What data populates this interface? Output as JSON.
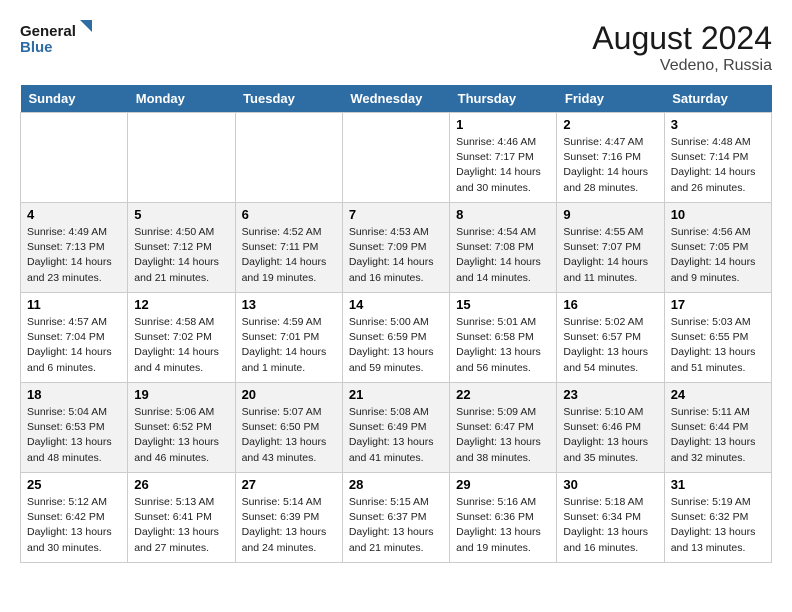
{
  "header": {
    "logo_line1": "General",
    "logo_line2": "Blue",
    "month_year": "August 2024",
    "location": "Vedeno, Russia"
  },
  "days_of_week": [
    "Sunday",
    "Monday",
    "Tuesday",
    "Wednesday",
    "Thursday",
    "Friday",
    "Saturday"
  ],
  "weeks": [
    [
      {
        "day": "",
        "info": ""
      },
      {
        "day": "",
        "info": ""
      },
      {
        "day": "",
        "info": ""
      },
      {
        "day": "",
        "info": ""
      },
      {
        "day": "1",
        "info": "Sunrise: 4:46 AM\nSunset: 7:17 PM\nDaylight: 14 hours\nand 30 minutes."
      },
      {
        "day": "2",
        "info": "Sunrise: 4:47 AM\nSunset: 7:16 PM\nDaylight: 14 hours\nand 28 minutes."
      },
      {
        "day": "3",
        "info": "Sunrise: 4:48 AM\nSunset: 7:14 PM\nDaylight: 14 hours\nand 26 minutes."
      }
    ],
    [
      {
        "day": "4",
        "info": "Sunrise: 4:49 AM\nSunset: 7:13 PM\nDaylight: 14 hours\nand 23 minutes."
      },
      {
        "day": "5",
        "info": "Sunrise: 4:50 AM\nSunset: 7:12 PM\nDaylight: 14 hours\nand 21 minutes."
      },
      {
        "day": "6",
        "info": "Sunrise: 4:52 AM\nSunset: 7:11 PM\nDaylight: 14 hours\nand 19 minutes."
      },
      {
        "day": "7",
        "info": "Sunrise: 4:53 AM\nSunset: 7:09 PM\nDaylight: 14 hours\nand 16 minutes."
      },
      {
        "day": "8",
        "info": "Sunrise: 4:54 AM\nSunset: 7:08 PM\nDaylight: 14 hours\nand 14 minutes."
      },
      {
        "day": "9",
        "info": "Sunrise: 4:55 AM\nSunset: 7:07 PM\nDaylight: 14 hours\nand 11 minutes."
      },
      {
        "day": "10",
        "info": "Sunrise: 4:56 AM\nSunset: 7:05 PM\nDaylight: 14 hours\nand 9 minutes."
      }
    ],
    [
      {
        "day": "11",
        "info": "Sunrise: 4:57 AM\nSunset: 7:04 PM\nDaylight: 14 hours\nand 6 minutes."
      },
      {
        "day": "12",
        "info": "Sunrise: 4:58 AM\nSunset: 7:02 PM\nDaylight: 14 hours\nand 4 minutes."
      },
      {
        "day": "13",
        "info": "Sunrise: 4:59 AM\nSunset: 7:01 PM\nDaylight: 14 hours\nand 1 minute."
      },
      {
        "day": "14",
        "info": "Sunrise: 5:00 AM\nSunset: 6:59 PM\nDaylight: 13 hours\nand 59 minutes."
      },
      {
        "day": "15",
        "info": "Sunrise: 5:01 AM\nSunset: 6:58 PM\nDaylight: 13 hours\nand 56 minutes."
      },
      {
        "day": "16",
        "info": "Sunrise: 5:02 AM\nSunset: 6:57 PM\nDaylight: 13 hours\nand 54 minutes."
      },
      {
        "day": "17",
        "info": "Sunrise: 5:03 AM\nSunset: 6:55 PM\nDaylight: 13 hours\nand 51 minutes."
      }
    ],
    [
      {
        "day": "18",
        "info": "Sunrise: 5:04 AM\nSunset: 6:53 PM\nDaylight: 13 hours\nand 48 minutes."
      },
      {
        "day": "19",
        "info": "Sunrise: 5:06 AM\nSunset: 6:52 PM\nDaylight: 13 hours\nand 46 minutes."
      },
      {
        "day": "20",
        "info": "Sunrise: 5:07 AM\nSunset: 6:50 PM\nDaylight: 13 hours\nand 43 minutes."
      },
      {
        "day": "21",
        "info": "Sunrise: 5:08 AM\nSunset: 6:49 PM\nDaylight: 13 hours\nand 41 minutes."
      },
      {
        "day": "22",
        "info": "Sunrise: 5:09 AM\nSunset: 6:47 PM\nDaylight: 13 hours\nand 38 minutes."
      },
      {
        "day": "23",
        "info": "Sunrise: 5:10 AM\nSunset: 6:46 PM\nDaylight: 13 hours\nand 35 minutes."
      },
      {
        "day": "24",
        "info": "Sunrise: 5:11 AM\nSunset: 6:44 PM\nDaylight: 13 hours\nand 32 minutes."
      }
    ],
    [
      {
        "day": "25",
        "info": "Sunrise: 5:12 AM\nSunset: 6:42 PM\nDaylight: 13 hours\nand 30 minutes."
      },
      {
        "day": "26",
        "info": "Sunrise: 5:13 AM\nSunset: 6:41 PM\nDaylight: 13 hours\nand 27 minutes."
      },
      {
        "day": "27",
        "info": "Sunrise: 5:14 AM\nSunset: 6:39 PM\nDaylight: 13 hours\nand 24 minutes."
      },
      {
        "day": "28",
        "info": "Sunrise: 5:15 AM\nSunset: 6:37 PM\nDaylight: 13 hours\nand 21 minutes."
      },
      {
        "day": "29",
        "info": "Sunrise: 5:16 AM\nSunset: 6:36 PM\nDaylight: 13 hours\nand 19 minutes."
      },
      {
        "day": "30",
        "info": "Sunrise: 5:18 AM\nSunset: 6:34 PM\nDaylight: 13 hours\nand 16 minutes."
      },
      {
        "day": "31",
        "info": "Sunrise: 5:19 AM\nSunset: 6:32 PM\nDaylight: 13 hours\nand 13 minutes."
      }
    ]
  ]
}
